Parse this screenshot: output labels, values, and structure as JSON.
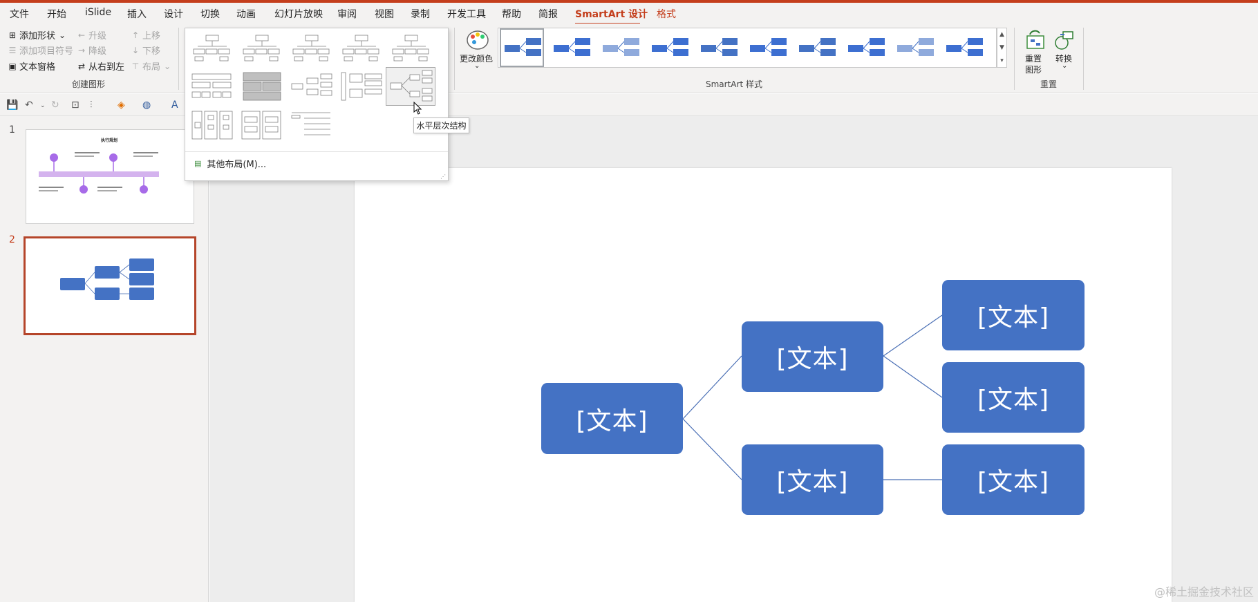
{
  "menu_tabs": [
    "文件",
    "开始",
    "iSlide",
    "插入",
    "设计",
    "切换",
    "动画",
    "幻灯片放映",
    "审阅",
    "视图",
    "录制",
    "开发工具",
    "帮助",
    "简报",
    "SmartArt 设计",
    "格式"
  ],
  "ribbon": {
    "create_group": {
      "add_shape": "添加形状",
      "add_bullet": "添加项目符号",
      "text_pane": "文本窗格",
      "promote": "升级",
      "demote": "降级",
      "right_to_left": "从右到左",
      "move_up": "上移",
      "move_down": "下移",
      "layout": "布局",
      "label": "创建图形"
    },
    "change_colors": "更改颜色",
    "styles_label": "SmartArt 样式",
    "reset_graphic_1": "重置",
    "reset_graphic_2": "图形",
    "convert": "转换",
    "reset_label": "重置"
  },
  "layout_dropdown": {
    "more_layouts": "其他布局(M)...",
    "tooltip": "水平层次结构"
  },
  "slides": [
    {
      "number": "1",
      "title": "执行规划"
    },
    {
      "number": "2"
    }
  ],
  "smartart": {
    "nodes": [
      "[文本]",
      "[文本]",
      "[文本]",
      "[文本]",
      "[文本]",
      "[文本]"
    ]
  },
  "colors": {
    "accent": "#c43e1c",
    "node_fill": "#4472c4",
    "connector": "#4a6fb5",
    "thumb_purple": "#d4b3ee",
    "thumb_circle": "#a76be8"
  },
  "watermark": "@稀土掘金技术社区"
}
